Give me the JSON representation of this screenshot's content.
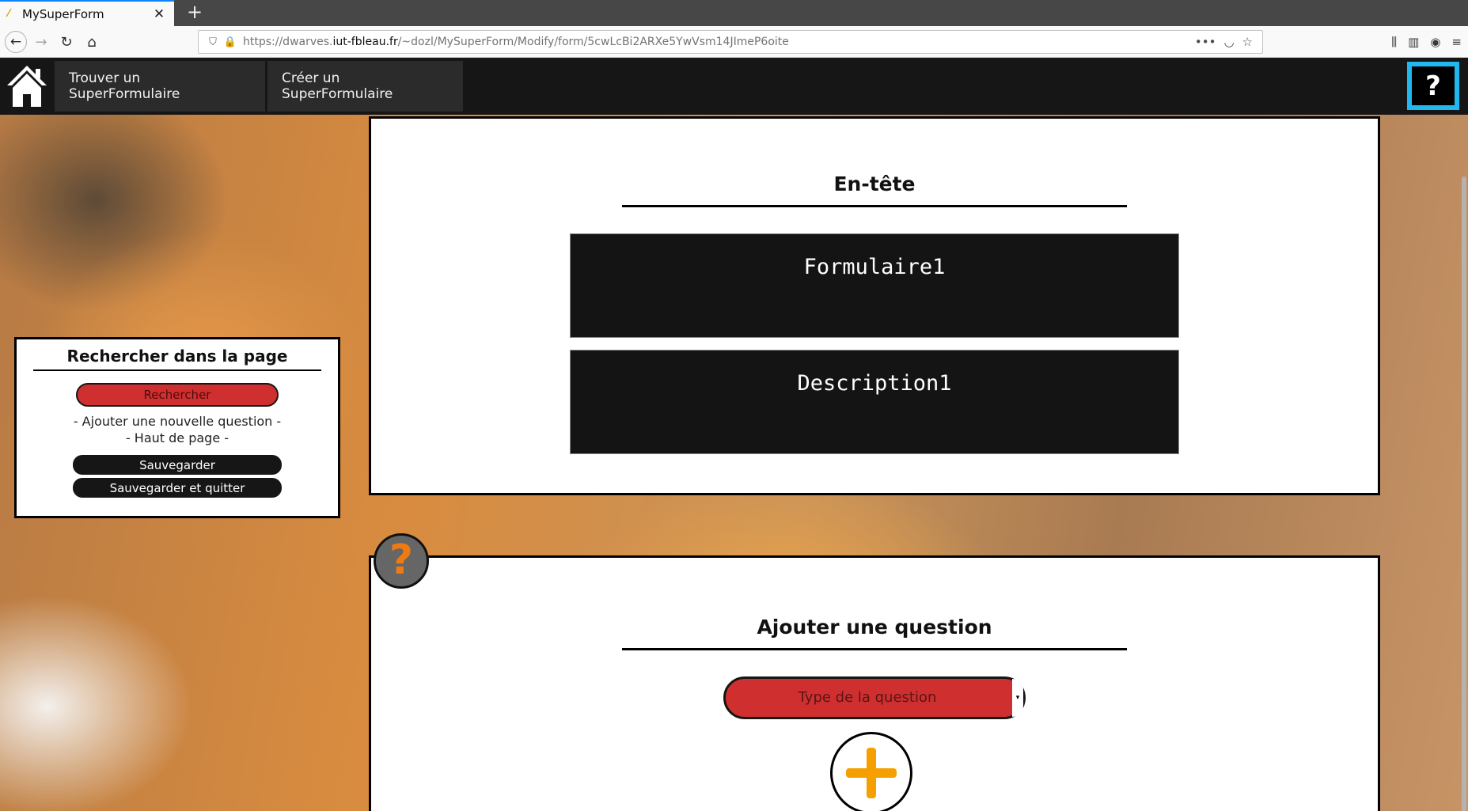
{
  "browser": {
    "tab_title": "MySuperForm",
    "tab_close": "✕",
    "new_tab": "+",
    "url_prefix": "https://dwarves.",
    "url_host": "iut-fbleau.fr",
    "url_path": "/~dozl/MySuperForm/Modify/form/5cwLcBi2ARXe5YwVsm14JImeP6oite",
    "icons": {
      "back": "←",
      "forward": "→",
      "reload": "↻",
      "home": "⌂",
      "shield": "⛉",
      "lock": "🔒",
      "more": "•••",
      "pocket": "◡",
      "bookmark": "☆",
      "library": "⫼",
      "sidebar": "▥",
      "account": "◉",
      "menu": "≡"
    }
  },
  "header": {
    "find_label": "Trouver un SuperFormulaire",
    "create_label": "Créer un SuperFormulaire",
    "help_label": "?"
  },
  "side_panel": {
    "title": "Rechercher dans la page",
    "search_button": "Rechercher",
    "add_question_link": "- Ajouter une nouvelle question -",
    "top_link": "- Haut de page -",
    "save_button": "Sauvegarder",
    "save_quit_button": "Sauvegarder et quitter"
  },
  "form_header": {
    "title": "En-tête",
    "form_title_value": "Formulaire1",
    "form_description_value": "Description1"
  },
  "add_question": {
    "help_badge": "?",
    "title": "Ajouter une question",
    "type_select_label": "Type de la question",
    "type_select_arrow": "▾"
  },
  "colors": {
    "accent_red": "#cf2f2f",
    "help_border": "#21b7ef",
    "plus_orange": "#f5a000",
    "header_bg": "#161616"
  }
}
